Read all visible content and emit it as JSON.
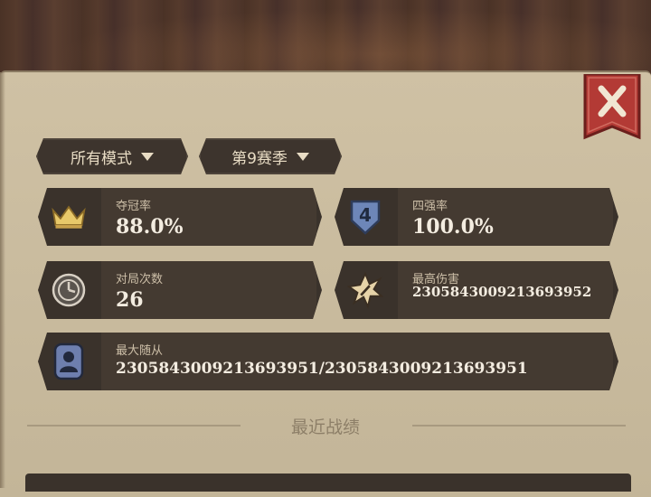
{
  "filters": {
    "mode_label": "所有模式",
    "season_label": "第9赛季"
  },
  "stats": [
    {
      "label": "夺冠率",
      "value": "88.0%",
      "icon": "crown-icon"
    },
    {
      "label": "四强率",
      "value": "100.0%",
      "icon": "badge-four-icon"
    },
    {
      "label": "对局次数",
      "value": "26",
      "icon": "clock-badge-icon"
    },
    {
      "label": "最高伤害",
      "value": "2305843009213693952",
      "icon": "star-burst-icon"
    },
    {
      "label": "最大随从",
      "value": "2305843009213693951/2305843009213693951",
      "icon": "portrait-icon"
    }
  ],
  "section_title": "最近战绩",
  "colors": {
    "panel": "#c8ba9d",
    "card": "#3a322b",
    "close_red": "#b33a35",
    "accent_gold": "#e8c96a"
  }
}
